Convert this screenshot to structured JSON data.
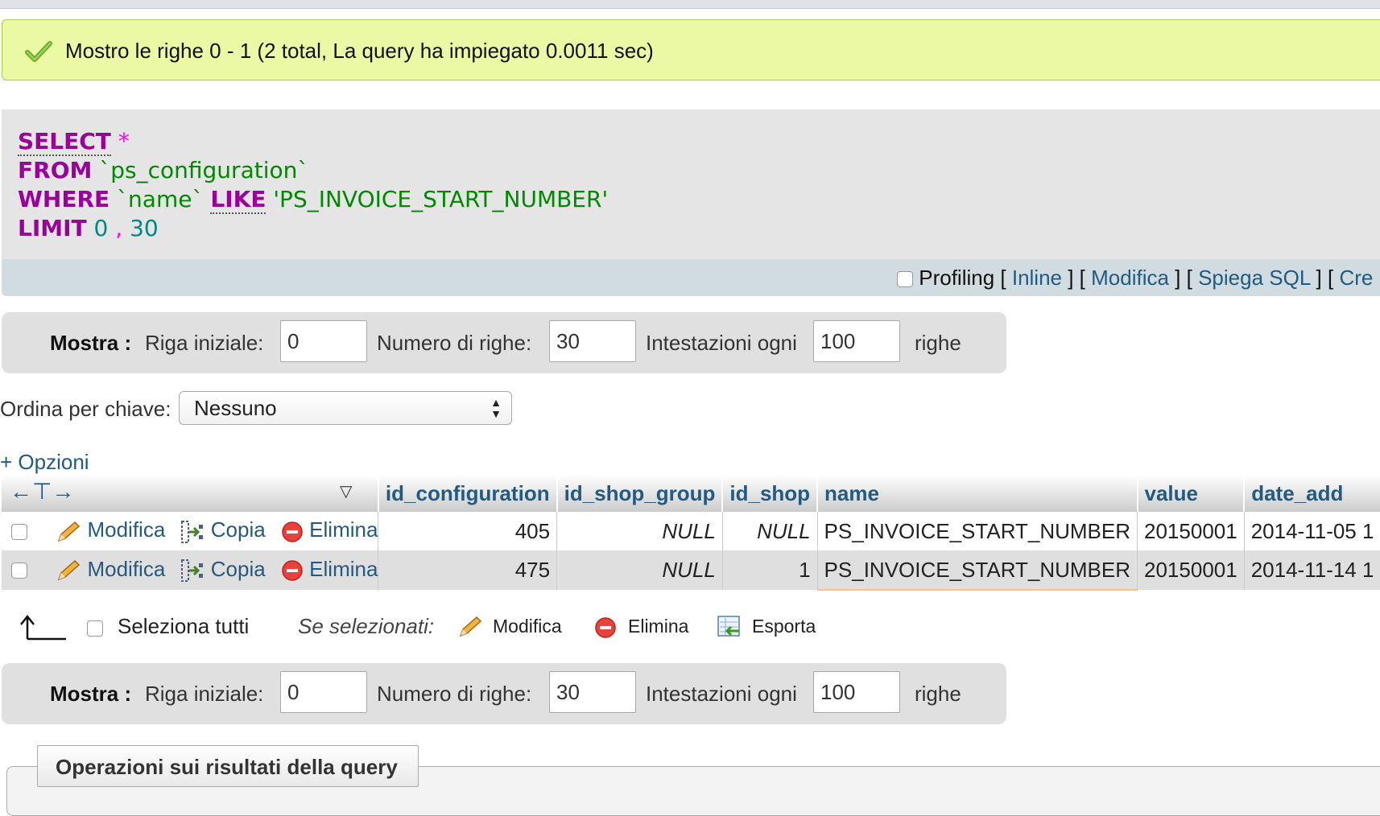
{
  "message": {
    "text": "Mostro le righe 0 - 1 (2 total, La query ha impiegato 0.0011 sec)"
  },
  "sql": {
    "select": "SELECT",
    "star": "*",
    "from": "FROM",
    "table": "`ps_configuration`",
    "where": "WHERE",
    "column": "`name`",
    "like": "LIKE",
    "value": "'PS_INVOICE_START_NUMBER'",
    "limit": "LIMIT",
    "offset": "0",
    "comma": ",",
    "count": "30"
  },
  "sql_links": {
    "profiling": "Profiling",
    "inline": "Inline",
    "edit": "Modifica",
    "explain": "Spiega SQL",
    "create": "Cre"
  },
  "nav": {
    "show_label": "Mostra :",
    "start_label": "Riga iniziale:",
    "start_value": "0",
    "rows_label": "Numero di righe:",
    "rows_value": "30",
    "headers_label": "Intestazioni ogni",
    "headers_value": "100",
    "rows_suffix": "righe"
  },
  "sort": {
    "label": "Ordina per chiave:",
    "value": "Nessuno"
  },
  "options_link": "+ Opzioni",
  "table": {
    "columns": [
      "id_configuration",
      "id_shop_group",
      "id_shop",
      "name",
      "value",
      "date_add"
    ],
    "actions": {
      "edit": "Modifica",
      "copy": "Copia",
      "delete": "Elimina"
    },
    "rows": [
      [
        "405",
        "NULL",
        "NULL",
        "PS_INVOICE_START_NUMBER",
        "20150001",
        "2014-11-05 1"
      ],
      [
        "475",
        "NULL",
        "1",
        "PS_INVOICE_START_NUMBER",
        "20150001",
        "2014-11-14 1"
      ]
    ]
  },
  "bulk": {
    "select_all": "Seleziona tutti",
    "if_selected": "Se selezionati:",
    "edit": "Modifica",
    "delete": "Elimina",
    "export": "Esporta"
  },
  "operations": {
    "title": "Operazioni sui risultati della query"
  },
  "colors": {
    "link": "#235a81",
    "success_bg": "#ebf8a4",
    "keyword": "#990099",
    "string": "#008800"
  }
}
